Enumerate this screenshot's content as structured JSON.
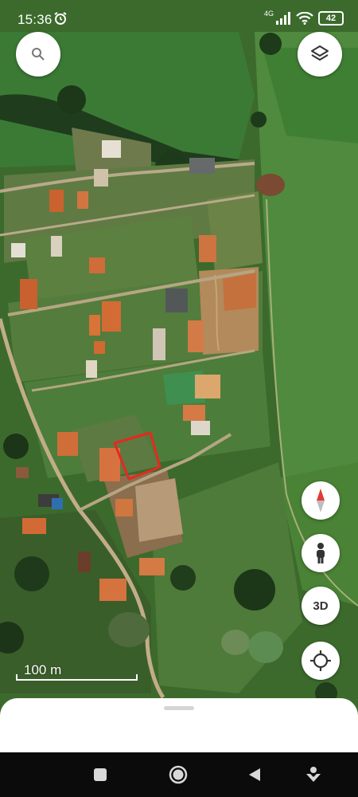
{
  "status_bar": {
    "time": "15:36",
    "network_type": "4G",
    "battery": "42",
    "icons": [
      "alarm-icon",
      "signal-icon",
      "wifi-icon",
      "battery-icon"
    ]
  },
  "map": {
    "type": "satellite",
    "scale_label": "100 m",
    "highlight_color": "#e8281e"
  },
  "controls": {
    "search_icon": "search-icon",
    "layers_icon": "layers-icon",
    "compass_icon": "compass-icon",
    "street_view_icon": "pegman-icon",
    "threed_label": "3D",
    "location_icon": "my-location-icon"
  },
  "navigation_bar": {
    "icons": [
      "recents-icon",
      "home-icon",
      "back-icon",
      "assistant-icon"
    ]
  }
}
